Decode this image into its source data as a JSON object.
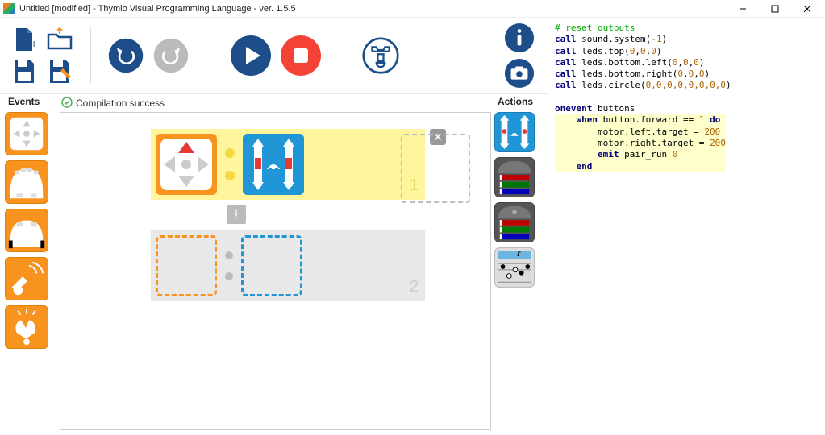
{
  "window": {
    "title": "Untitled [modified] - Thymio Visual Programming Language - ver. 1.5.5"
  },
  "labels": {
    "events": "Events",
    "actions": "Actions"
  },
  "status": {
    "message": "Compilation success"
  },
  "events_palette": [
    {
      "icon": "buttons-icon"
    },
    {
      "icon": "prox-horizontal-icon"
    },
    {
      "icon": "prox-ground-icon"
    },
    {
      "icon": "tap-icon"
    },
    {
      "icon": "clap-icon"
    }
  ],
  "actions_palette": [
    {
      "icon": "motors-icon"
    },
    {
      "icon": "top-color-icon"
    },
    {
      "icon": "bottom-color-icon"
    },
    {
      "icon": "music-icon"
    }
  ],
  "rows": {
    "r1_num": "1",
    "r2_num": "2"
  },
  "toolbar": {
    "new": "new",
    "open": "open",
    "save": "save",
    "saveas": "saveas",
    "undo": "undo",
    "redo": "redo",
    "run": "run",
    "stop": "stop",
    "advanced": "advanced",
    "info": "info",
    "snapshot": "snapshot"
  },
  "code": {
    "l1": "# reset outputs",
    "l2a": "call",
    "l2b": " sound.system(",
    "l2c": "-1",
    "l2d": ")",
    "l3a": "call",
    "l3b": " leds.top(",
    "l3c": "0",
    "l3d": ",",
    "l3e": "0",
    "l3f": ",",
    "l3g": "0",
    "l3h": ")",
    "l4a": "call",
    "l4b": " leds.bottom.left(",
    "l4c": "0",
    "l4d": ",",
    "l4e": "0",
    "l4f": ",",
    "l4g": "0",
    "l4h": ")",
    "l5a": "call",
    "l5b": " leds.bottom.right(",
    "l5c": "0",
    "l5d": ",",
    "l5e": "0",
    "l5f": ",",
    "l5g": "0",
    "l5h": ")",
    "l6a": "call",
    "l6b": " leds.circle(",
    "l6c": "0,0,0,0,0,0,0,0",
    "l6d": ")",
    "l7": "",
    "l8a": "onevent",
    "l8b": " buttons",
    "l9a": "    when",
    "l9b": " button.forward == ",
    "l9c": "1",
    "l9d": " do",
    "l10a": "        motor.left.target = ",
    "l10b": "200",
    "l11a": "        motor.right.target = ",
    "l11b": "200",
    "l12a": "        emit",
    "l12b": " pair_run ",
    "l12c": "0",
    "l13": "    end"
  }
}
